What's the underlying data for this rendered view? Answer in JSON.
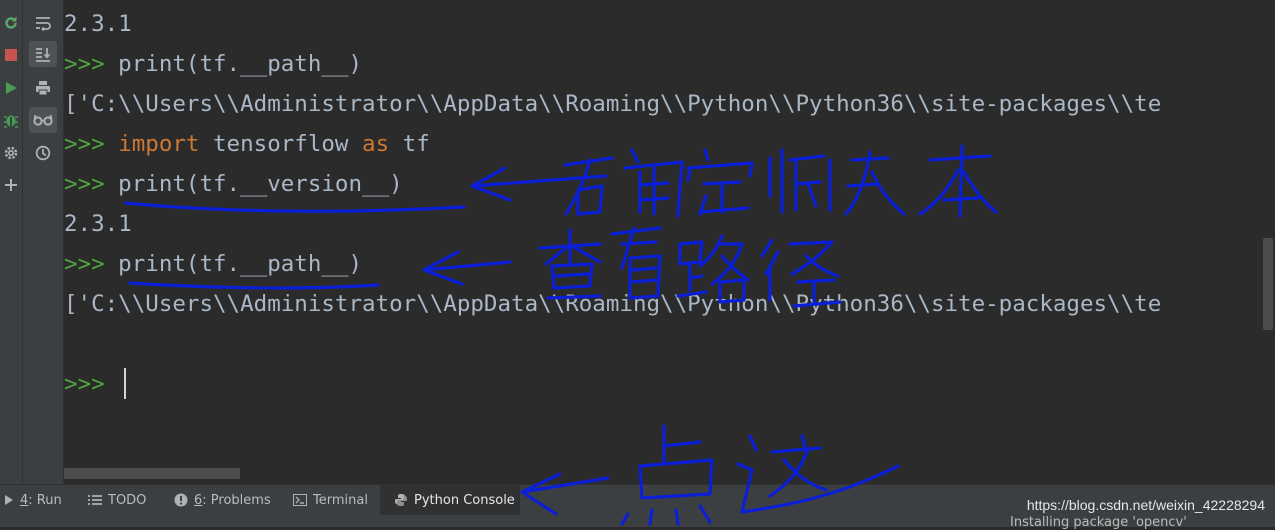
{
  "left_toolbar": {
    "items": [
      {
        "icon": "rerun-icon"
      },
      {
        "icon": "stop-icon"
      },
      {
        "icon": "run-icon"
      },
      {
        "icon": "debug-bug-icon"
      },
      {
        "icon": "settings-gear-icon"
      },
      {
        "icon": "add-plus-icon"
      }
    ]
  },
  "side_toolbar": {
    "items": [
      {
        "icon": "soft-wrap-icon"
      },
      {
        "icon": "scroll-to-end-icon",
        "active": true
      },
      {
        "icon": "print-icon"
      },
      {
        "icon": "show-variables-glasses-icon",
        "active": true
      },
      {
        "icon": "history-clock-icon"
      }
    ]
  },
  "console": {
    "lines": [
      {
        "text": "2.3.1"
      },
      {
        "prompt": ">>>",
        "code": " print(tf.__path__)"
      },
      {
        "text": "['C:\\\\Users\\\\Administrator\\\\AppData\\\\Roaming\\\\Python\\\\Python36\\\\site-packages\\\\te"
      },
      {
        "prompt": ">>>",
        "kw1": "import",
        "mid": " tensorflow ",
        "kw2": "as",
        "end": " tf"
      },
      {
        "prompt": ">>>",
        "code": " print(tf.__version__)"
      },
      {
        "text": "2.3.1"
      },
      {
        "prompt": ">>>",
        "code": " print(tf.__path__)"
      },
      {
        "text": "['C:\\\\Users\\\\Administrator\\\\AppData\\\\Roaming\\\\Python\\\\Python36\\\\site-packages\\\\te"
      },
      {
        "prompt": ">>>"
      }
    ]
  },
  "bottom_tabs": [
    {
      "mnemonic": "4",
      "label": ": Run",
      "icon": "run-triangle-icon"
    },
    {
      "label": "TODO",
      "icon": "todo-list-icon"
    },
    {
      "mnemonic": "6",
      "label": ": Problems",
      "icon": "problems-alert-icon"
    },
    {
      "label": "Terminal",
      "icon": "terminal-icon"
    },
    {
      "label": "Python Console",
      "icon": "python-logo-icon",
      "active": true
    }
  ],
  "status": {
    "url": "https://blog.csdn.net/weixin_42228294",
    "message": "Installing package 'opencv'"
  },
  "colors": {
    "background": "#2b2b2b",
    "toolbar": "#3c3f41",
    "prompt": "#4ea83d",
    "keyword": "#cc7832",
    "text": "#a9b7c6",
    "ink": "#0b1fd6"
  }
}
